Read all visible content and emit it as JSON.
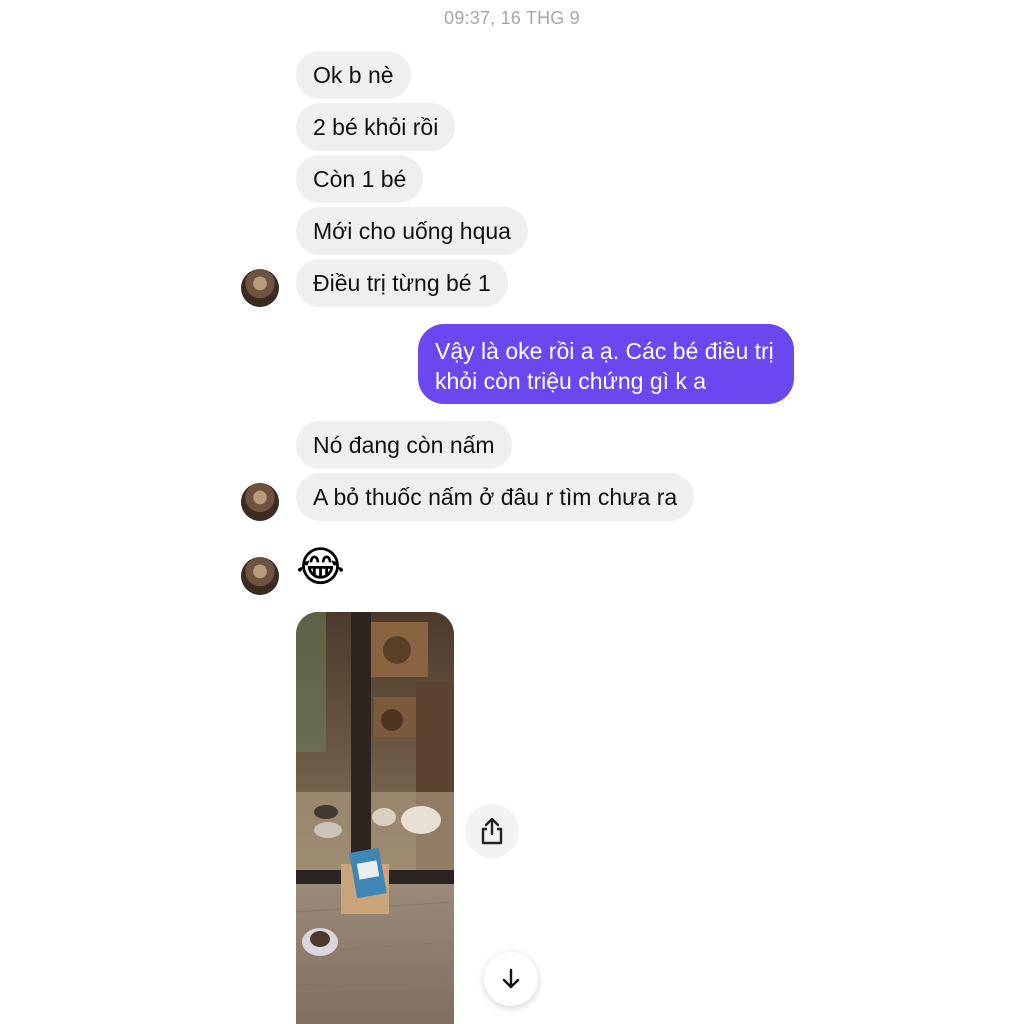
{
  "timestamp": "09:37, 16 THG 9",
  "incoming_group_1": [
    "Ok b nè",
    "2 bé khỏi rồi",
    "Còn 1 bé",
    "Mới cho uống hqua",
    "Điều trị từng bé 1"
  ],
  "outgoing_message": {
    "line1": "Vậy là oke rồi a ạ. Các bé điều trị",
    "line2": "khỏi còn triệu chứng gì k a"
  },
  "incoming_group_2": [
    "Nó đang còn nấm",
    "A bỏ thuốc nấm ở đâu r tìm chưa ra"
  ],
  "emoji_message": "😂",
  "icons": {
    "avatar": "avatar",
    "share": "share-icon",
    "scroll_down": "arrow-down-icon"
  },
  "colors": {
    "incoming_bubble": "#efefef",
    "outgoing_bubble": "#6a47ef",
    "timestamp": "#a6a6a6"
  }
}
